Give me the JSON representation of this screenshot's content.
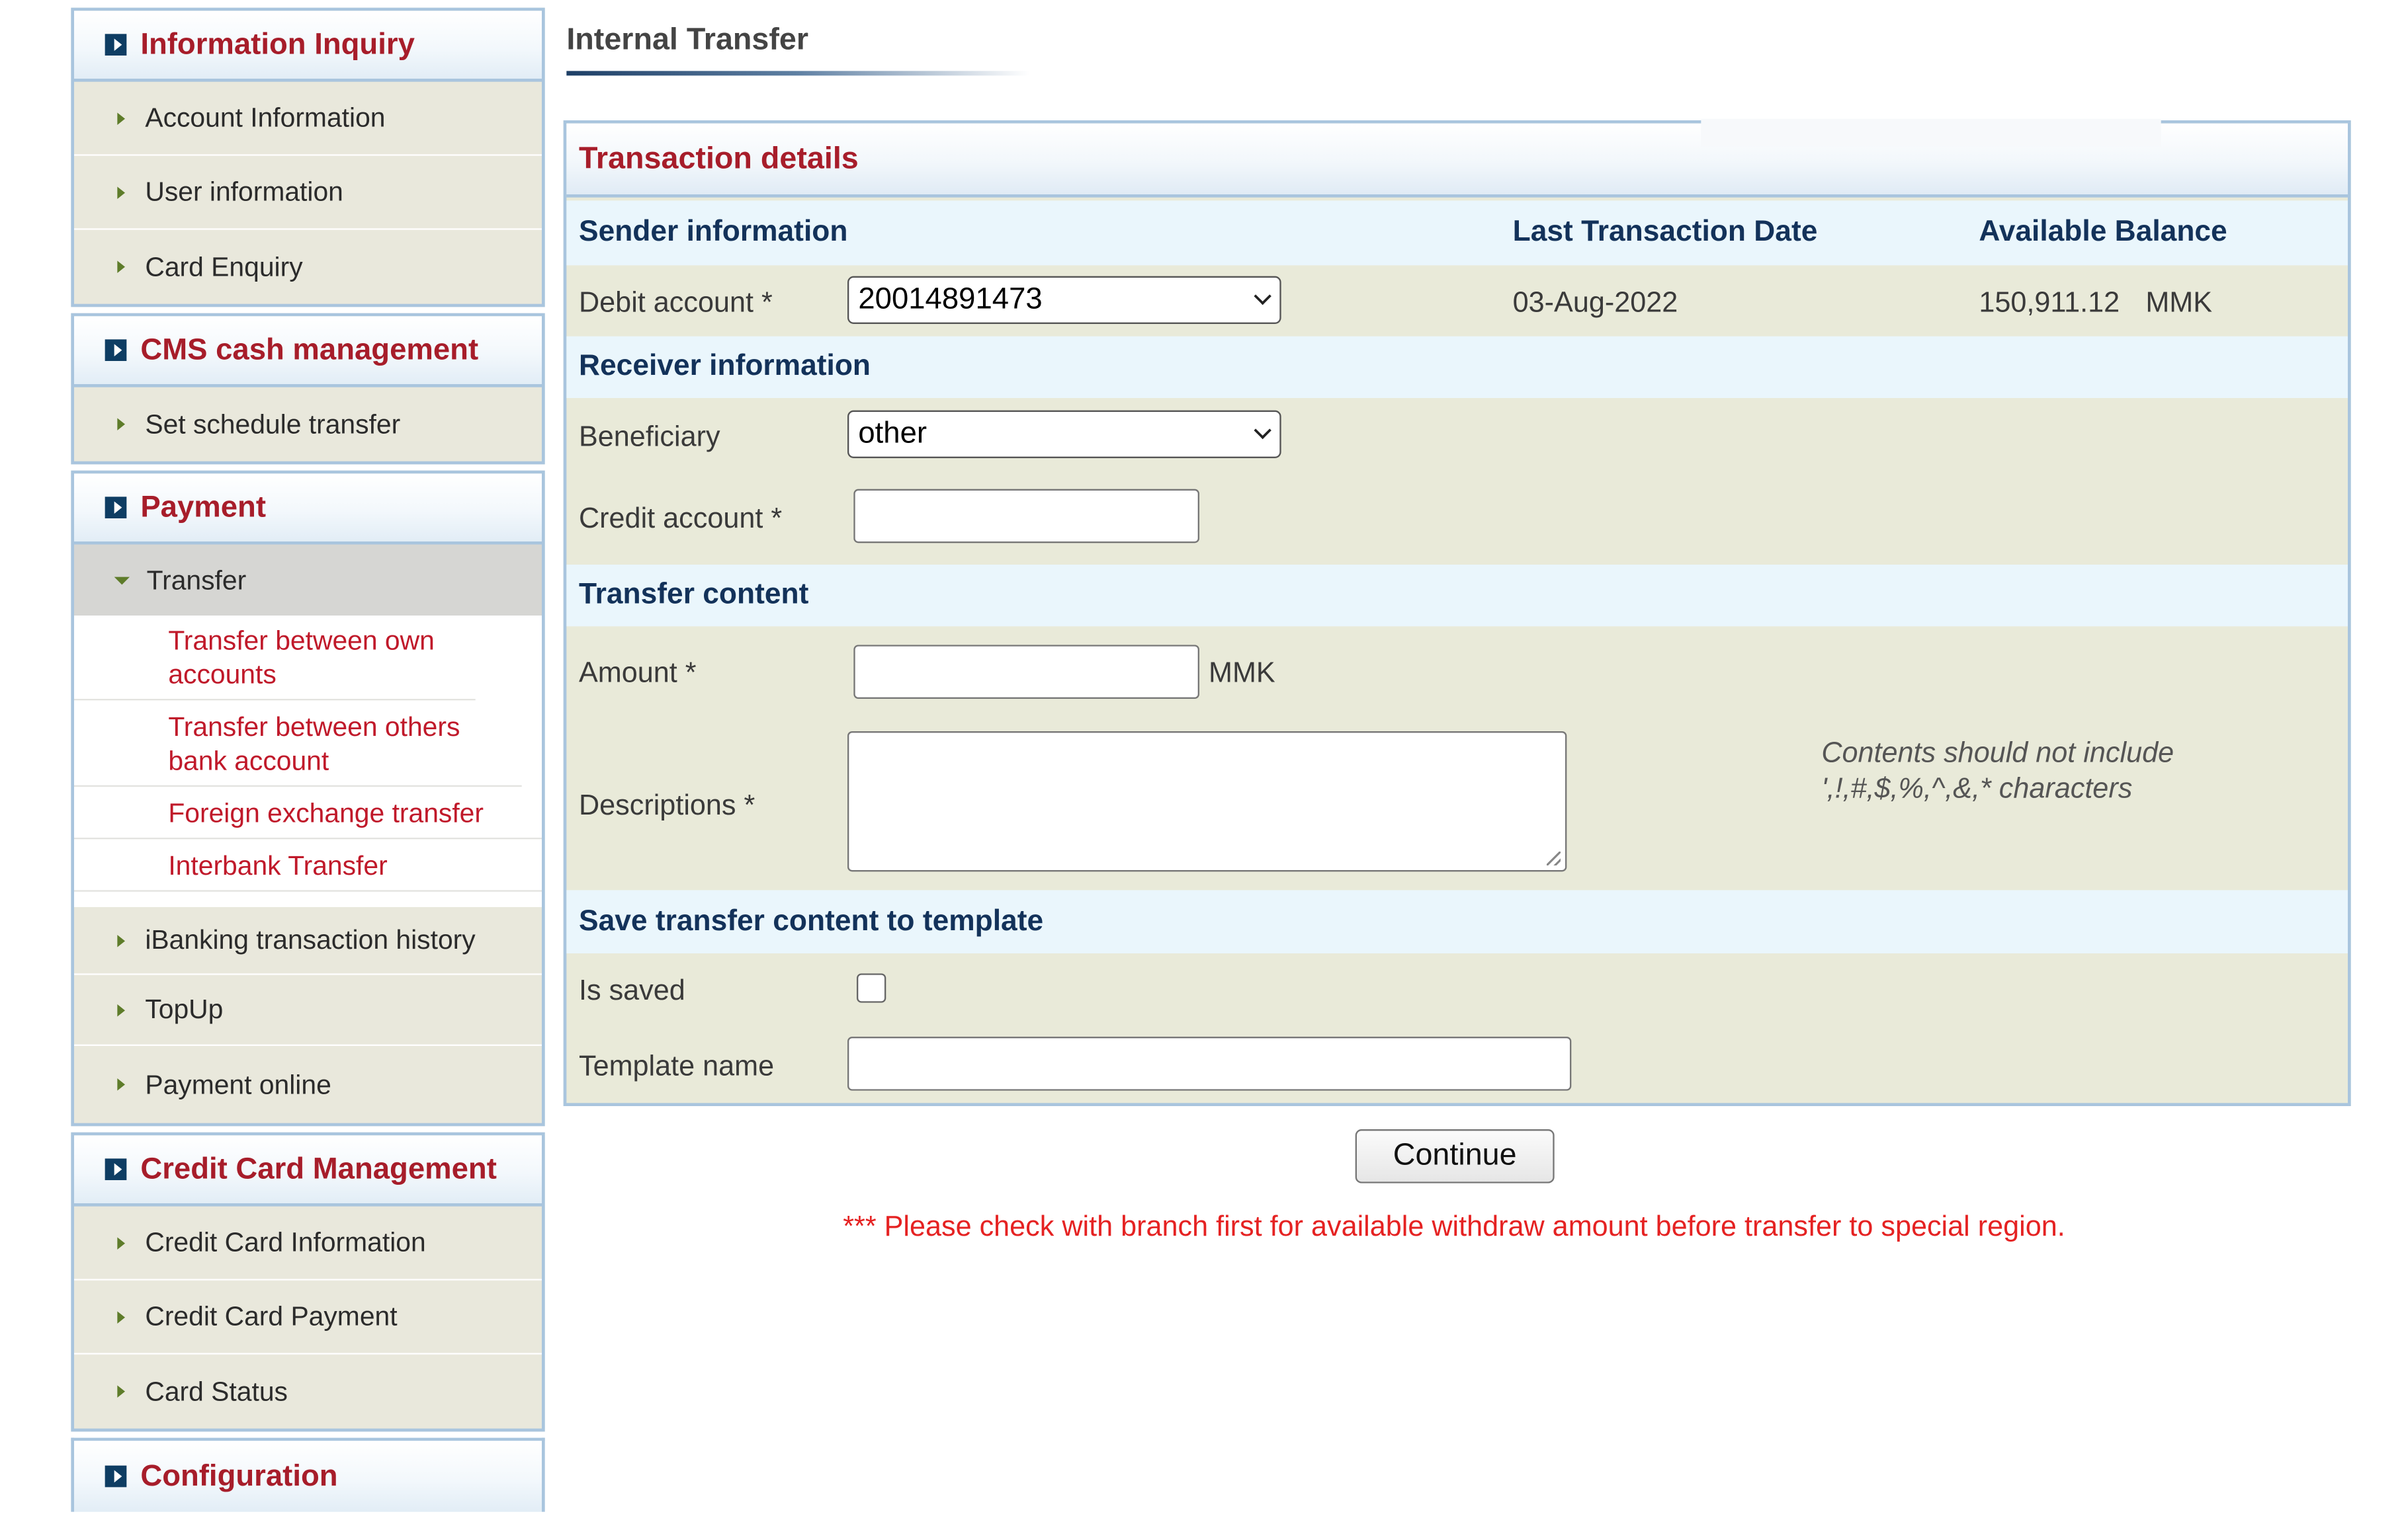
{
  "sidebar": {
    "groups": [
      {
        "title": "Information Inquiry",
        "items": [
          "Account Information",
          "User information",
          "Card Enquiry"
        ]
      },
      {
        "title": "CMS cash management",
        "items": [
          "Set schedule transfer"
        ]
      },
      {
        "title": "Payment",
        "active_item": "Transfer",
        "sub_items": [
          "Transfer between own accounts",
          "Transfer between others bank account",
          "Foreign exchange transfer",
          "Interbank Transfer"
        ],
        "items": [
          "iBanking transaction history",
          "TopUp",
          "Payment online"
        ]
      },
      {
        "title": "Credit Card Management",
        "items": [
          "Credit Card Information",
          "Credit Card Payment",
          "Card Status"
        ]
      },
      {
        "title": "Configuration",
        "items": []
      }
    ]
  },
  "page": {
    "title": "Internal Transfer"
  },
  "form": {
    "panel_title": "Transaction details",
    "sender": {
      "section": "Sender information",
      "col_last_date": "Last Transaction Date",
      "col_balance": "Available Balance",
      "debit_label": "Debit account *",
      "debit_value": "20014891473",
      "last_date": "03-Aug-2022",
      "balance": "150,911.12",
      "balance_currency": "MMK"
    },
    "receiver": {
      "section": "Receiver information",
      "beneficiary_label": "Beneficiary",
      "beneficiary_value": "other",
      "credit_label": "Credit account *",
      "credit_value": ""
    },
    "content": {
      "section": "Transfer content",
      "amount_label": "Amount *",
      "amount_value": "",
      "amount_currency": "MMK",
      "desc_label": "Descriptions *",
      "desc_value": "",
      "hint": "Contents should not include ',!,#,$,%,^,&,* characters"
    },
    "template": {
      "section": "Save transfer content to template",
      "is_saved_label": "Is saved",
      "is_saved": false,
      "template_name_label": "Template name",
      "template_name_value": ""
    }
  },
  "actions": {
    "continue_label": "Continue"
  },
  "notice": "*** Please check with branch first for available withdraw amount before transfer to special region.",
  "colors": {
    "brand_red": "#a71d2a",
    "section_navy": "#13325a",
    "notice_red": "#e52222",
    "panel_bg": "#e9ead9",
    "section_bg": "#eaf6fc"
  }
}
